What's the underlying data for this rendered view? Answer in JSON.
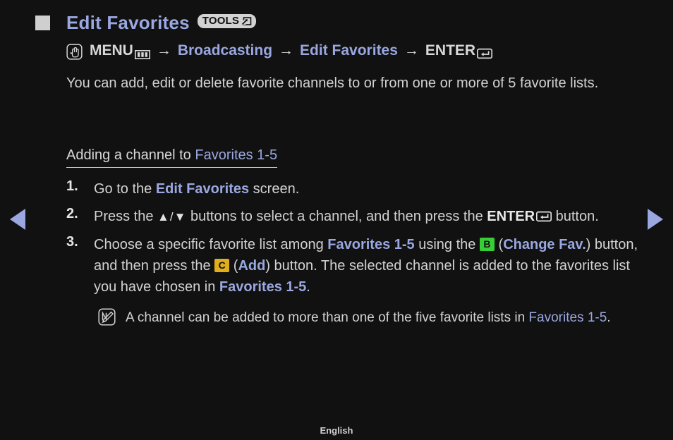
{
  "page": {
    "background_color": "#111111",
    "accent_blue": "#9aa7e0",
    "text_gray": "#d2d2d2"
  },
  "nav": {
    "prev_label": "◀",
    "next_label": "▶"
  },
  "header": {
    "title": "Edit Favorites",
    "tools_badge_label": "TOOLS"
  },
  "menu_path": {
    "menu_label": "MENU",
    "arrow": "→",
    "item1": "Broadcasting",
    "item2": "Edit Favorites",
    "enter_label": "ENTER"
  },
  "intro": {
    "text": "You can add, edit or delete favorite channels to or from one or more of 5 favorite lists."
  },
  "section": {
    "heading_prefix": "Adding a channel to ",
    "heading_highlight": "Favorites 1-5"
  },
  "steps": [
    {
      "number": "1.",
      "parts": [
        {
          "text": "Go to the ",
          "style": "normal"
        },
        {
          "text": "Edit Favorites",
          "style": "blue-bold"
        },
        {
          "text": " screen.",
          "style": "normal"
        }
      ]
    },
    {
      "number": "2.",
      "parts": [
        {
          "text": "Press the ",
          "style": "normal"
        },
        {
          "text": "▲/▼",
          "style": "triangle"
        },
        {
          "text": " buttons to select a channel, and then press the ",
          "style": "normal"
        },
        {
          "text": "ENTER",
          "style": "white-bold"
        },
        {
          "text": " button.",
          "style": "normal"
        }
      ]
    },
    {
      "number": "3.",
      "parts": [
        {
          "text": "Choose a specific favorite list among ",
          "style": "normal"
        },
        {
          "text": "Favorites 1-5",
          "style": "blue-bold"
        },
        {
          "text": " using the ",
          "style": "normal"
        },
        {
          "text": "B",
          "style": "badge-green"
        },
        {
          "text": " (",
          "style": "normal"
        },
        {
          "text": "Change Fav.",
          "style": "blue-bold"
        },
        {
          "text": ") button, and then press the ",
          "style": "normal"
        },
        {
          "text": "C",
          "style": "badge-yellow"
        },
        {
          "text": " (",
          "style": "normal"
        },
        {
          "text": "Add",
          "style": "blue-bold"
        },
        {
          "text": ") button. The selected channel is added to the favorites list you have chosen in ",
          "style": "normal"
        },
        {
          "text": "Favorites 1-5",
          "style": "blue-bold"
        },
        {
          "text": ".",
          "style": "normal"
        }
      ]
    }
  ],
  "note": {
    "prefix": "A channel can be added to more than one of the five favorite lists in ",
    "highlight": "Favorites 1-5",
    "suffix": "."
  },
  "footer": {
    "language": "English"
  },
  "icons": {
    "bullet": "filled-square",
    "tools": "tools-arrow-box",
    "press": "hand-press",
    "menu_key": "menu-grid",
    "enter_key": "enter-return",
    "note": "note-pencil"
  }
}
